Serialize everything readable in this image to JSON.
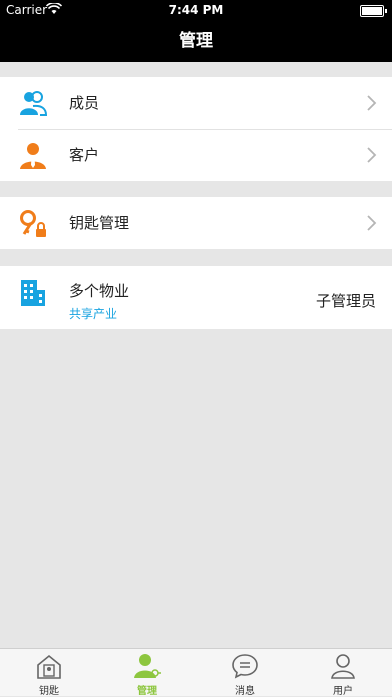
{
  "status_bar": {
    "carrier": "Carrier",
    "time": "7:44 PM"
  },
  "nav": {
    "title": "管理"
  },
  "menu": {
    "members": "成员",
    "customers": "客户",
    "key_management": "钥匙管理"
  },
  "property": {
    "title": "多个物业",
    "subtitle": "共享产业",
    "role": "子管理员"
  },
  "tabs": [
    {
      "label": "钥匙",
      "icon": "house-key-icon"
    },
    {
      "label": "管理",
      "icon": "manager-icon"
    },
    {
      "label": "消息",
      "icon": "chat-bubble-icon"
    },
    {
      "label": "用户",
      "icon": "user-icon"
    }
  ],
  "colors": {
    "accent_blue": "#18a3e0",
    "accent_orange": "#f07d1a",
    "active_tab": "#8dc63f"
  }
}
